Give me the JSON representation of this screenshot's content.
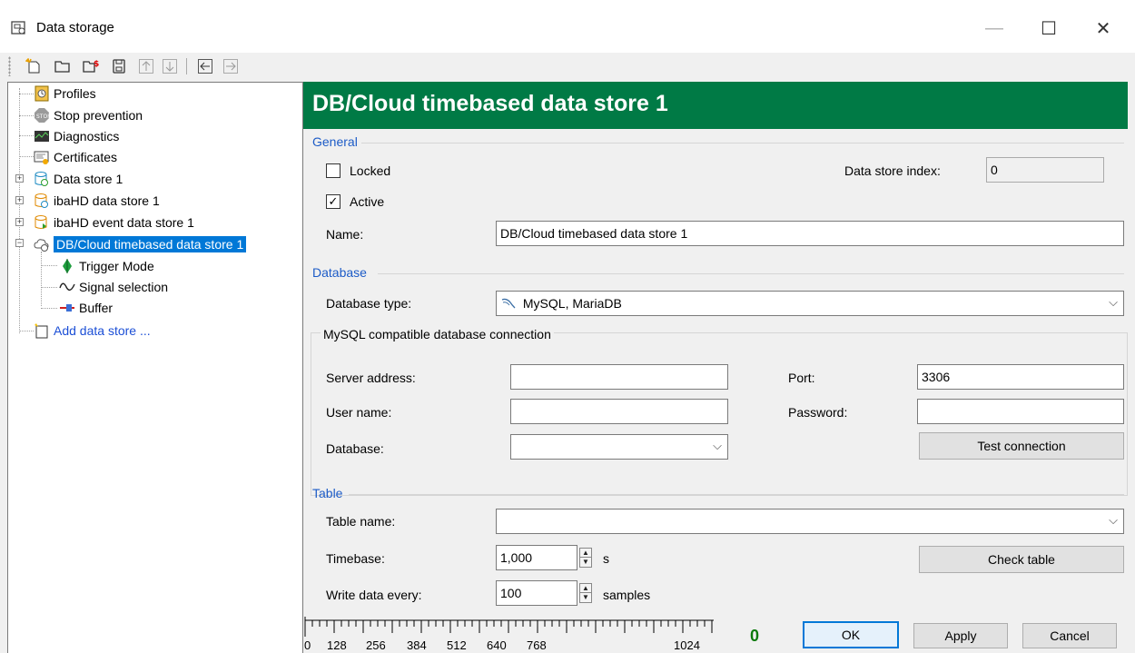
{
  "window": {
    "title": "Data storage",
    "app_icon": "data-storage-icon",
    "controls": {
      "minimize": "—",
      "maximize": "☐",
      "close": "✕"
    }
  },
  "toolbar": {
    "icons": [
      "new-icon",
      "open-folder-icon",
      "open-file-icon",
      "save-icon",
      "move-up-icon",
      "move-down-icon",
      "collapse-icon",
      "expand-icon"
    ]
  },
  "tree": {
    "items": [
      {
        "label": "Profiles",
        "icon": "profiles-icon"
      },
      {
        "label": "Stop prevention",
        "icon": "stop-icon"
      },
      {
        "label": "Diagnostics",
        "icon": "diagnostics-icon"
      },
      {
        "label": "Certificates",
        "icon": "certificate-icon"
      },
      {
        "label": "Data store 1",
        "icon": "data-store-icon"
      },
      {
        "label": "ibaHD data store 1",
        "icon": "hd-store-icon"
      },
      {
        "label": "ibaHD event data store 1",
        "icon": "hd-event-store-icon"
      },
      {
        "label": "DB/Cloud timebased data store 1",
        "icon": "cloud-store-icon"
      },
      {
        "label": "Trigger Mode",
        "icon": "trigger-icon"
      },
      {
        "label": "Signal selection",
        "icon": "signal-icon"
      },
      {
        "label": "Buffer",
        "icon": "buffer-icon"
      },
      {
        "label": "Add data store ...",
        "icon": "add-store-icon"
      }
    ]
  },
  "header": {
    "title": "DB/Cloud timebased data store 1",
    "color": "#007a45"
  },
  "general": {
    "section_title": "General",
    "locked_label": "Locked",
    "locked_checked": false,
    "active_label": "Active",
    "active_checked": true,
    "index_label": "Data store index:",
    "index_value": "0",
    "name_label": "Name:",
    "name_value": "DB/Cloud timebased data store 1"
  },
  "database": {
    "section_title": "Database",
    "type_label": "Database type:",
    "type_value": "MySQL, MariaDB",
    "group_title": "MySQL compatible database connection",
    "server_label": "Server address:",
    "server_value": "",
    "port_label": "Port:",
    "port_value": "3306",
    "user_label": "User name:",
    "user_value": "",
    "password_label": "Password:",
    "password_value": "",
    "db_label": "Database:",
    "db_value": "",
    "test_button": "Test connection"
  },
  "table": {
    "section_title": "Table",
    "name_label": "Table name:",
    "name_value": "",
    "timebase_label": "Timebase:",
    "timebase_value": "1,000",
    "timebase_unit": "s",
    "write_label": "Write data every:",
    "write_value": "100",
    "write_unit": "samples",
    "check_button": "Check table"
  },
  "footer": {
    "ruler_labels": [
      "0",
      "128",
      "256",
      "384",
      "512",
      "640",
      "768",
      "1024"
    ],
    "counter": "0",
    "ok": "OK",
    "apply": "Apply",
    "cancel": "Cancel"
  }
}
